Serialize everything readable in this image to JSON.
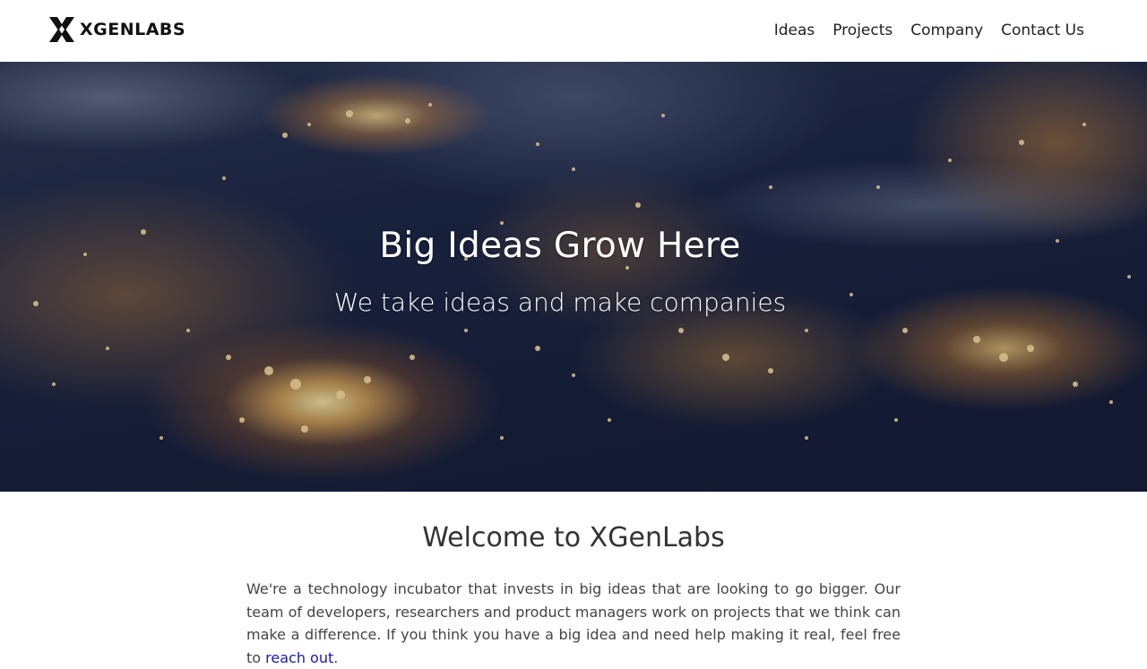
{
  "header": {
    "logo_text": "XGENLABS",
    "nav": [
      {
        "label": "Ideas"
      },
      {
        "label": "Projects"
      },
      {
        "label": "Company"
      },
      {
        "label": "Contact Us"
      }
    ]
  },
  "hero": {
    "title": "Big Ideas Grow Here",
    "subtitle": "We take ideas and make companies"
  },
  "welcome": {
    "title": "Welcome to XGenLabs",
    "body_text": "We're a technology incubator that invests in big ideas that are looking to go bigger. Our team of developers, researchers and product managers work on projects that we think can make a difference. If you think you have a big idea and need help making it real, feel free to ",
    "link_text": "reach out",
    "trailing_text": "."
  },
  "colors": {
    "link": "#1a1aa6",
    "heading": "#333333",
    "body": "#444444"
  }
}
